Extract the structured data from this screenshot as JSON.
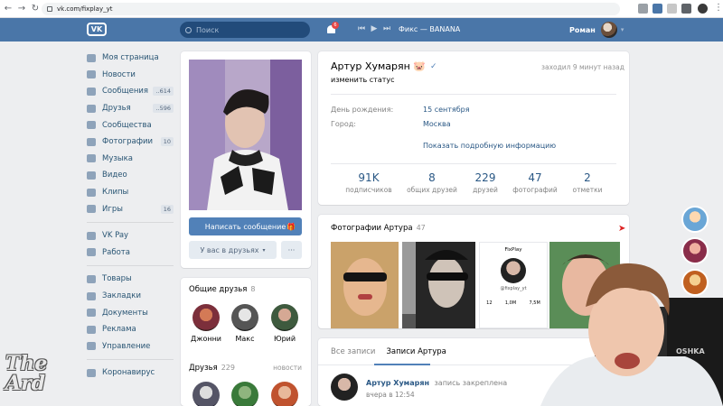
{
  "browser": {
    "url": "vk.com/fixplay_yt"
  },
  "header": {
    "logo": "VK",
    "search_placeholder": "Поиск",
    "notifications_badge": "6",
    "track": "Фикс — BANANA",
    "user_name": "Роман"
  },
  "sidebar": {
    "items": [
      {
        "label": "Моя страница",
        "icon": "home-icon",
        "count": ""
      },
      {
        "label": "Новости",
        "icon": "news-icon",
        "count": ""
      },
      {
        "label": "Сообщения",
        "icon": "messages-icon",
        "count": "..614"
      },
      {
        "label": "Друзья",
        "icon": "friends-icon",
        "count": "..596"
      },
      {
        "label": "Сообщества",
        "icon": "communities-icon",
        "count": ""
      },
      {
        "label": "Фотографии",
        "icon": "camera-icon",
        "count": "10"
      },
      {
        "label": "Музыка",
        "icon": "music-icon",
        "count": ""
      },
      {
        "label": "Видео",
        "icon": "video-icon",
        "count": ""
      },
      {
        "label": "Клипы",
        "icon": "clips-icon",
        "count": ""
      },
      {
        "label": "Игры",
        "icon": "games-icon",
        "count": "16"
      }
    ],
    "items2": [
      {
        "label": "VK Pay",
        "icon": "vkpay-icon"
      },
      {
        "label": "Работа",
        "icon": "work-icon"
      }
    ],
    "items3": [
      {
        "label": "Товары",
        "icon": "goods-icon"
      },
      {
        "label": "Закладки",
        "icon": "bookmarks-icon"
      },
      {
        "label": "Документы",
        "icon": "documents-icon"
      },
      {
        "label": "Реклама",
        "icon": "ads-icon"
      },
      {
        "label": "Управление",
        "icon": "manage-icon"
      }
    ],
    "items4": [
      {
        "label": "Коронавирус",
        "icon": "globe-icon"
      }
    ]
  },
  "left_col": {
    "message_button": "Написать сообщение",
    "friends_button": "У вас в друзьях",
    "more_button": "···",
    "common_friends": {
      "title": "Общие друзья",
      "count": "8",
      "names": [
        "Джонни",
        "Макс",
        "Юрий"
      ]
    },
    "friends": {
      "title": "Друзья",
      "count": "229",
      "link": "новости"
    }
  },
  "profile": {
    "name": "Артур Хумарян 🐷",
    "online": "заходил 9 минут назад",
    "status": "изменить статус",
    "birthday_label": "День рождения:",
    "birthday_value": "15 сентября",
    "city_label": "Город:",
    "city_value": "Москва",
    "more_info": "Показать подробную информацию",
    "stats": [
      {
        "num": "91K",
        "cap": "подписчиков"
      },
      {
        "num": "8",
        "cap": "общих друзей"
      },
      {
        "num": "229",
        "cap": "друзей"
      },
      {
        "num": "47",
        "cap": "фотографий"
      },
      {
        "num": "2",
        "cap": "отметки"
      }
    ]
  },
  "photos": {
    "title": "Фотографии Артура",
    "count": "47",
    "mini_profile": {
      "name": "FixPlay",
      "handle": "@fixplay_yt",
      "stats": [
        "12",
        "1,0M",
        "7,5M"
      ]
    }
  },
  "wall": {
    "tabs": [
      "Все записи",
      "Записи Артура"
    ],
    "post_author": "Артур Хумарян",
    "post_action": "запись закреплена",
    "post_time": "вчера в 12:54"
  },
  "overlay": {
    "watermark_line1": "The",
    "watermark_line2": "Ard",
    "webcam_chair_text": "OSHKA"
  }
}
